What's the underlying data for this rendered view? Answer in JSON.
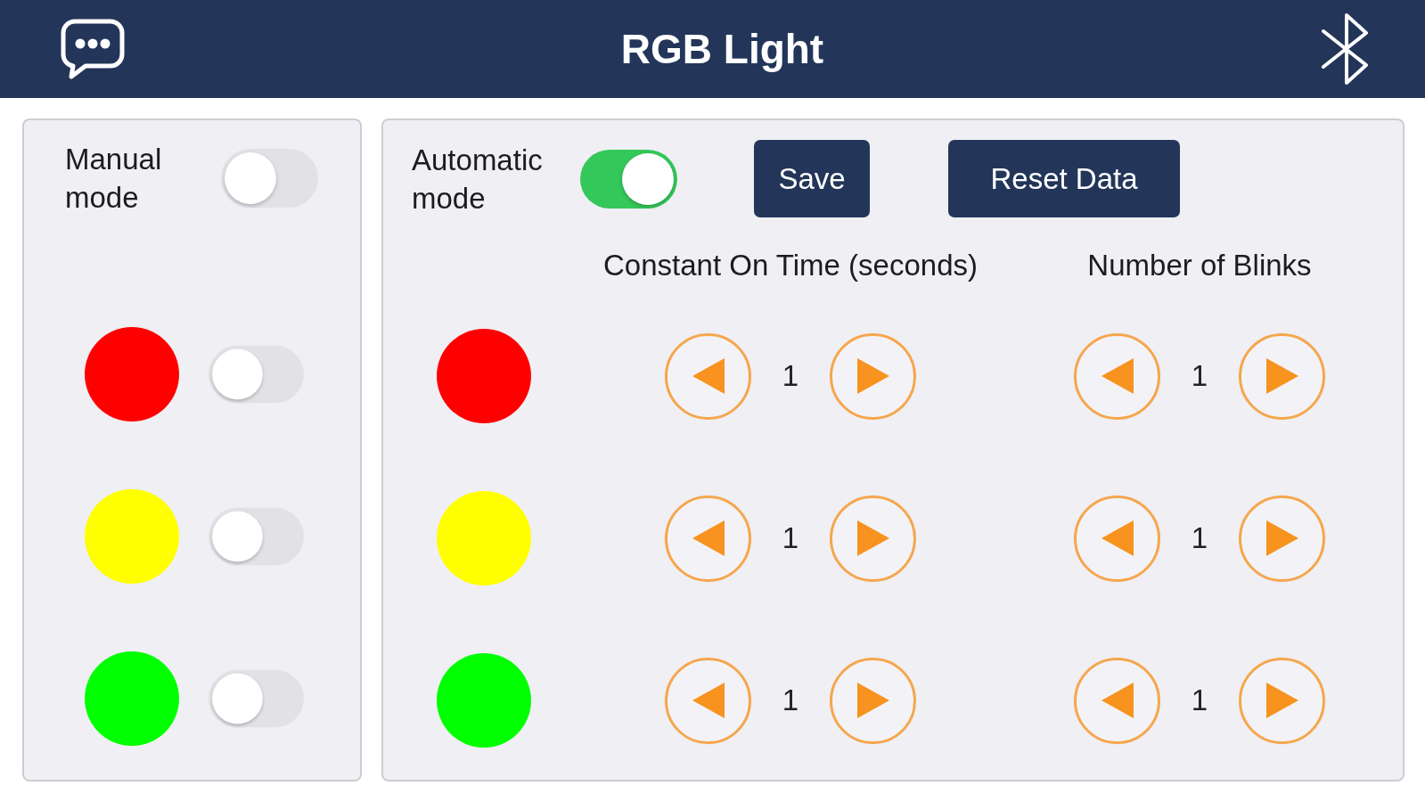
{
  "header": {
    "title": "RGB Light"
  },
  "manual": {
    "label": "Manual mode",
    "on": false,
    "lights": [
      {
        "color": "#ff0000",
        "on": false
      },
      {
        "color": "#ffff00",
        "on": false
      },
      {
        "color": "#00ff00",
        "on": false
      }
    ]
  },
  "automatic": {
    "label": "Automatic mode",
    "on": true,
    "buttons": [
      "Save",
      "Reset Data"
    ],
    "columns": [
      "Constant On Time (seconds)",
      "Number of Blinks"
    ],
    "rows": [
      {
        "color": "#ff0000",
        "on_time": "1",
        "blinks": "1"
      },
      {
        "color": "#ffff00",
        "on_time": "1",
        "blinks": "1"
      },
      {
        "color": "#00ff00",
        "on_time": "1",
        "blinks": "1"
      }
    ]
  }
}
